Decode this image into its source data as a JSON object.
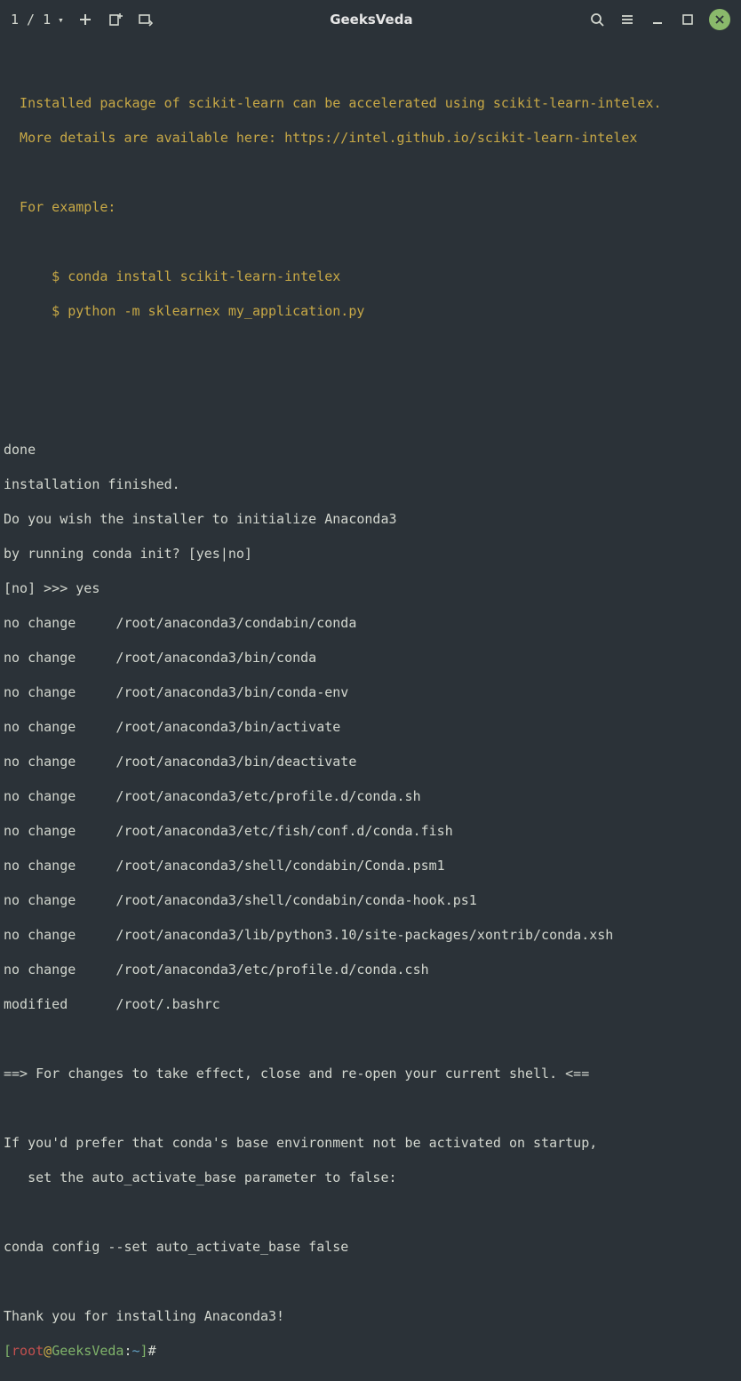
{
  "titlebar": {
    "tab_counter": "1 / 1",
    "title": "GeeksVeda"
  },
  "lines": {
    "l1": "  Installed package of scikit-learn can be accelerated using scikit-learn-intelex.",
    "l2": "  More details are available here: https://intel.github.io/scikit-learn-intelex",
    "l3": "  For example:",
    "l4": "      $ conda install scikit-learn-intelex",
    "l5": "      $ python -m sklearnex my_application.py",
    "done": "done",
    "instfin": "installation finished.",
    "q1": "Do you wish the installer to initialize Anaconda3",
    "q2": "by running conda init? [yes|no]",
    "ans": "[no] >>> yes",
    "nc0": "no change     /root/anaconda3/condabin/conda",
    "nc1": "no change     /root/anaconda3/bin/conda",
    "nc2": "no change     /root/anaconda3/bin/conda-env",
    "nc3": "no change     /root/anaconda3/bin/activate",
    "nc4": "no change     /root/anaconda3/bin/deactivate",
    "nc5": "no change     /root/anaconda3/etc/profile.d/conda.sh",
    "nc6": "no change     /root/anaconda3/etc/fish/conf.d/conda.fish",
    "nc7": "no change     /root/anaconda3/shell/condabin/Conda.psm1",
    "nc8": "no change     /root/anaconda3/shell/condabin/conda-hook.ps1",
    "nc9": "no change     /root/anaconda3/lib/python3.10/site-packages/xontrib/conda.xsh",
    "nc10": "no change     /root/anaconda3/etc/profile.d/conda.csh",
    "mod": "modified      /root/.bashrc",
    "eff": "==> For changes to take effect, close and re-open your current shell. <==",
    "pref1": "If you'd prefer that conda's base environment not be activated on startup,",
    "pref2": "   set the auto_activate_base parameter to false:",
    "cmd": "conda config --set auto_activate_base false",
    "thanks": "Thank you for installing Anaconda3!"
  },
  "prompt": {
    "open": "[",
    "user": "root",
    "at": "@",
    "host": "GeeksVeda",
    "sep": ":",
    "cwd": "~",
    "close": "]",
    "sym": "#"
  }
}
